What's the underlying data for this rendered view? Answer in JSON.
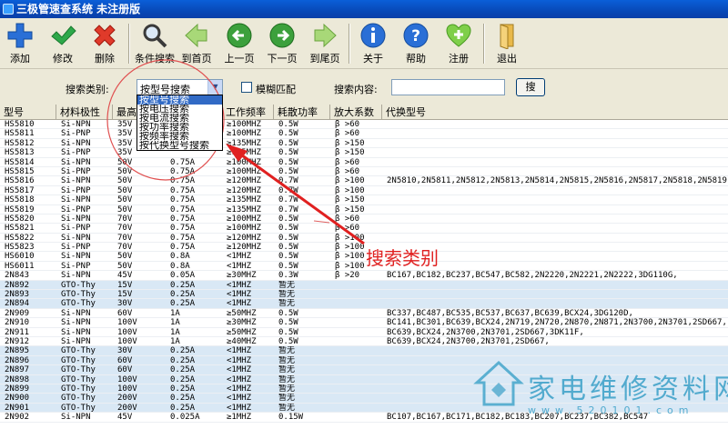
{
  "window": {
    "title": "三极管速查系统  未注册版"
  },
  "toolbar": {
    "add": "添加",
    "edit": "修改",
    "delete": "删除",
    "search": "条件搜索",
    "first": "到首页",
    "prev": "上一页",
    "next": "下一页",
    "last": "到尾页",
    "about": "关于",
    "help": "帮助",
    "register": "注册",
    "exit": "退出"
  },
  "searchbar": {
    "category_label": "搜索类别:",
    "category_value": "按型号搜索",
    "fuzzy_label": "模糊匹配",
    "content_label": "搜索内容:",
    "search_button": "搜"
  },
  "dropdown": {
    "options": [
      "按型号搜索",
      "按电压搜索",
      "按电流搜索",
      "按功率搜索",
      "按频率搜索",
      "按代换型号搜索"
    ]
  },
  "annotation": {
    "text": "搜索类别"
  },
  "watermark": {
    "title": "家电维修资料网",
    "url": "www.520101.com"
  },
  "grid": {
    "columns": [
      "型号",
      "材料极性",
      "最高",
      "",
      "工作频率",
      "耗散功率",
      "放大系数",
      "代换型号"
    ],
    "rows": [
      [
        "HS5810",
        "Si-NPN",
        "35V",
        "",
        "≥100MHZ",
        "0.5W",
        "β >60",
        "",
        ""
      ],
      [
        "HS5811",
        "Si-PNP",
        "35V",
        "",
        "≥100MHZ",
        "0.5W",
        "β >60",
        "",
        ""
      ],
      [
        "HS5812",
        "Si-NPN",
        "35V",
        "",
        "≥135MHZ",
        "0.5W",
        "β >150",
        "",
        ""
      ],
      [
        "HS5813",
        "Si-PNP",
        "35V",
        "",
        "≥135MHZ",
        "0.5W",
        "β >150",
        "",
        ""
      ],
      [
        "HS5814",
        "Si-NPN",
        "50V",
        "0.75A",
        "≥100MHZ",
        "0.5W",
        "β >60",
        "",
        ""
      ],
      [
        "HS5815",
        "Si-PNP",
        "50V",
        "0.75A",
        "≥100MHZ",
        "0.5W",
        "β >60",
        "",
        ""
      ],
      [
        "HS5816",
        "Si-NPN",
        "50V",
        "0.75A",
        "≥120MHZ",
        "0.7W",
        "β >100",
        "2N5810,2N5811,2N5812,2N5813,2N5814,2N5815,2N5816,2N5817,2N5818,2N5819,2N58",
        ""
      ],
      [
        "HS5817",
        "Si-PNP",
        "50V",
        "0.75A",
        "≥120MHZ",
        "0.7W",
        "β >100",
        "",
        ""
      ],
      [
        "HS5818",
        "Si-NPN",
        "50V",
        "0.75A",
        "≥135MHZ",
        "0.7W",
        "β >150",
        "",
        ""
      ],
      [
        "HS5819",
        "Si-PNP",
        "50V",
        "0.75A",
        "≥135MHZ",
        "0.7W",
        "β >150",
        "",
        ""
      ],
      [
        "HS5820",
        "Si-NPN",
        "70V",
        "0.75A",
        "≥100MHZ",
        "0.5W",
        "β >60",
        "",
        ""
      ],
      [
        "HS5821",
        "Si-PNP",
        "70V",
        "0.75A",
        "≥100MHZ",
        "0.5W",
        "β >60",
        "",
        ""
      ],
      [
        "HS5822",
        "Si-NPN",
        "70V",
        "0.75A",
        "≥120MHZ",
        "0.5W",
        "β >100",
        "",
        ""
      ],
      [
        "HS5823",
        "Si-PNP",
        "70V",
        "0.75A",
        "≥120MHZ",
        "0.5W",
        "β >100",
        "",
        ""
      ],
      [
        "HS6010",
        "Si-NPN",
        "50V",
        "0.8A",
        "<1MHZ",
        "0.5W",
        "β >100",
        "",
        ""
      ],
      [
        "HS6011",
        "Si-PNP",
        "50V",
        "0.8A",
        "<1MHZ",
        "0.5W",
        "β >100",
        "",
        ""
      ],
      [
        "2N843",
        "Si-NPN",
        "45V",
        "0.05A",
        "≥30MHZ",
        "0.3W",
        "β >20",
        "BC167,BC182,BC237,BC547,BC582,2N2220,2N2221,2N2222,3DG110G,",
        ""
      ],
      [
        "2N892",
        "GTO-Thy",
        "15V",
        "0.25A",
        "<1MHZ",
        "暂无",
        "",
        "",
        "blue"
      ],
      [
        "2N893",
        "GTO-Thy",
        "15V",
        "0.25A",
        "<1MHZ",
        "暂无",
        "",
        "",
        "blue"
      ],
      [
        "2N894",
        "GTO-Thy",
        "30V",
        "0.25A",
        "<1MHZ",
        "暂无",
        "",
        "",
        "blue"
      ],
      [
        "2N909",
        "Si-NPN",
        "60V",
        "1A",
        "≥50MHZ",
        "0.5W",
        "",
        "BC337,BC487,BC535,BC537,BC637,BC639,BCX24,3DG120D,",
        ""
      ],
      [
        "2N910",
        "Si-NPN",
        "100V",
        "1A",
        "≥30MHZ",
        "0.5W",
        "",
        "BC141,BC301,BC639,BCX24,2N719,2N720,2N870,2N871,2N3700,2N3701,2SD667,",
        ""
      ],
      [
        "2N911",
        "Si-NPN",
        "100V",
        "1A",
        "≥50MHZ",
        "0.5W",
        "",
        "BC639,BCX24,2N3700,2N3701,2SD667,3DK11F,",
        ""
      ],
      [
        "2N912",
        "Si-NPN",
        "100V",
        "1A",
        "≥40MHZ",
        "0.5W",
        "",
        "BC639,BCX24,2N3700,2N3701,2SD667,",
        ""
      ],
      [
        "2N895",
        "GTO-Thy",
        "30V",
        "0.25A",
        "<1MHZ",
        "暂无",
        "",
        "",
        "blue"
      ],
      [
        "2N896",
        "GTO-Thy",
        "60V",
        "0.25A",
        "<1MHZ",
        "暂无",
        "",
        "",
        "blue"
      ],
      [
        "2N897",
        "GTO-Thy",
        "60V",
        "0.25A",
        "<1MHZ",
        "暂无",
        "",
        "",
        "blue"
      ],
      [
        "2N898",
        "GTO-Thy",
        "100V",
        "0.25A",
        "<1MHZ",
        "暂无",
        "",
        "",
        "blue"
      ],
      [
        "2N899",
        "GTO-Thy",
        "100V",
        "0.25A",
        "<1MHZ",
        "暂无",
        "",
        "",
        "blue"
      ],
      [
        "2N900",
        "GTO-Thy",
        "200V",
        "0.25A",
        "<1MHZ",
        "暂无",
        "",
        "",
        "blue"
      ],
      [
        "2N901",
        "GTO-Thy",
        "200V",
        "0.25A",
        "<1MHZ",
        "暂无",
        "",
        "",
        "blue"
      ],
      [
        "2N902",
        "Si-NPN",
        "45V",
        "0.025A",
        "≥1MHZ",
        "0.15W",
        "",
        "BC107,BC167,BC171,BC182,BC183,BC207,BC237,BC382,BC547",
        ""
      ]
    ]
  }
}
